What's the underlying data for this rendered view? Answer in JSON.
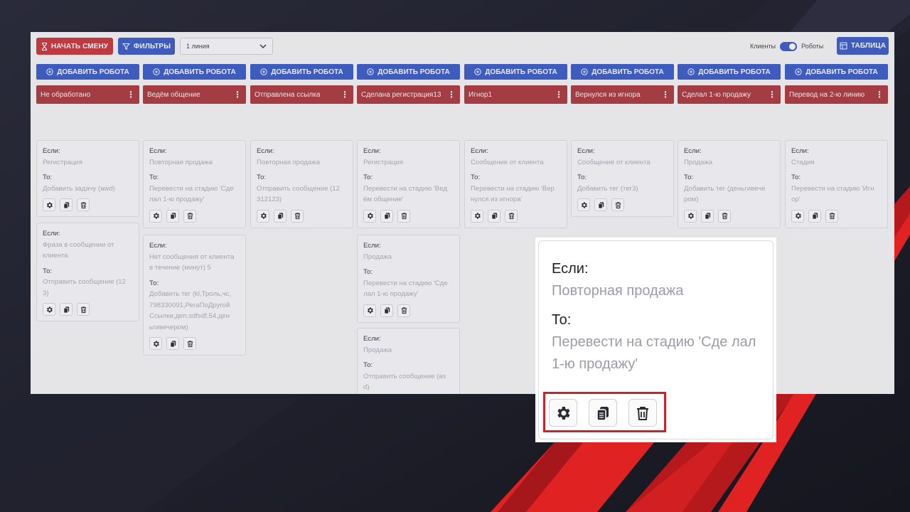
{
  "toolbar": {
    "start_shift_label": "НАЧАТЬ СМЕНУ",
    "filters_label": "ФИЛЬТРЫ",
    "line_select_value": "1 линия",
    "toggle_left_label": "Клиенты",
    "toggle_right_label": "Роботы",
    "table_label": "ТАБЛИЦА"
  },
  "add_robot_label": "ДОБАВИТЬ РОБОТА",
  "labels": {
    "if": "Если:",
    "then": "То:"
  },
  "columns": [
    {
      "name": "Не обработано",
      "cards": [
        {
          "if": "Регистрация",
          "then": "Добавить задачу (awd)"
        },
        {
          "if": "Фраза в сообщении от клиента",
          "then": "Отправить сообщение (12 3)"
        }
      ]
    },
    {
      "name": "Ведём общение",
      "cards": [
        {
          "if": "Повторная продажа",
          "then": "Перевести на стадию 'Сде лал 1-ю продажу'"
        },
        {
          "if": "Нет сообщения от клиента в течение (минут) 5",
          "then": "Добавить тег (kl,Троль,чс, 798330091,РегаПоДругой Ссылки,деп,sdfsdf,54,ден ьгивечером)"
        }
      ]
    },
    {
      "name": "Отправлена ссылка",
      "cards": [
        {
          "if": "Повторная продажа",
          "then": "Отправить сообщение (12 312123)"
        }
      ]
    },
    {
      "name": "Сделана регистрация13",
      "cards": [
        {
          "if": "Регистрация",
          "then": "Перевести на стадию 'Вед ём общение'"
        },
        {
          "if": "Продажа",
          "then": "Перевести на стадию 'Сде лал 1-ю продажу'"
        },
        {
          "if": "Продажа",
          "then": "Отправить сообщение (as d)"
        }
      ]
    },
    {
      "name": "Игнор1",
      "cards": [
        {
          "if": "Сообщение от клиента",
          "then": "Перевести на стадию 'Вер нулся из игнора'"
        }
      ]
    },
    {
      "name": "Вернулся из игнора",
      "cards": [
        {
          "if": "Сообщение от клиента",
          "then": "Добавить тег (тег3)"
        }
      ]
    },
    {
      "name": "Сделал 1-ю продажу",
      "cards": [
        {
          "if": "Продажа",
          "then": "Добавить тег (деньгивече ром)"
        }
      ]
    },
    {
      "name": "Перевод на 2-ю линию",
      "cards": [
        {
          "if": "Стадия",
          "then": "Перевести на стадию 'Игн ор'"
        }
      ]
    }
  ],
  "zoom": {
    "if_label": "Если:",
    "if_value": "Повторная продажа",
    "then_label": "То:",
    "then_value": "Перевести на стадию 'Сде лал 1-ю продажу'",
    "highlight_color": "#c8242b"
  },
  "colors": {
    "accent_blue": "#3a5bc2",
    "stage_red": "#a63a3f",
    "start_button_red": "#c2373d",
    "background_dark": "#1b1c27",
    "stripe_red": "#e02222"
  },
  "icons": [
    "hourglass-icon",
    "filter-icon",
    "chevron-down-icon",
    "table-icon",
    "plus-circle-icon",
    "more-vertical-icon",
    "gear-icon",
    "copy-icon",
    "trash-icon"
  ]
}
